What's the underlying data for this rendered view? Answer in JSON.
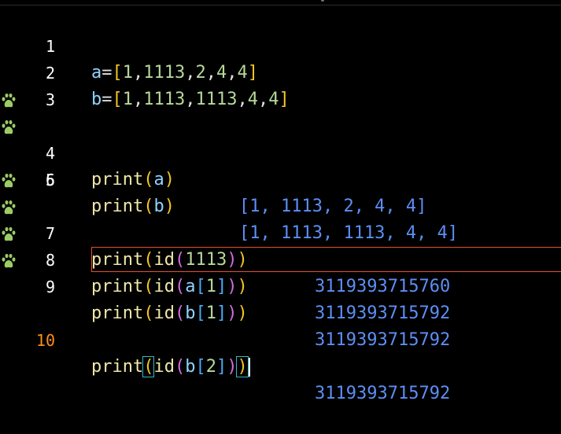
{
  "editor": {
    "active_line": "10",
    "lines": [
      {
        "num": "1",
        "code": [
          "a",
          "=",
          "[",
          "1",
          ",",
          "1113",
          ",",
          "2",
          ",",
          "4",
          ",",
          "4",
          "]"
        ],
        "result": ""
      },
      {
        "num": "2",
        "code": [
          "b",
          "=",
          "[",
          "1",
          ",",
          "1113",
          ",",
          "1113",
          ",",
          "4",
          ",",
          "4",
          "]"
        ],
        "result": ""
      },
      {
        "num": "3",
        "code": [],
        "result": ""
      },
      {
        "num": "4",
        "code": [
          "print",
          "(",
          "a",
          ")"
        ],
        "result": "[1, 1113, 2, 4, 4]"
      },
      {
        "num": "5",
        "code": [
          "print",
          "(",
          "b",
          ")"
        ],
        "result": "[1, 1113, 1113, 4, 4]"
      },
      {
        "num": "6",
        "code": [],
        "result": ""
      },
      {
        "num": "7",
        "code": [
          "print",
          "(",
          "id",
          "(",
          "1113",
          ")",
          ")"
        ],
        "result": "3119393715760"
      },
      {
        "num": "8",
        "code": [
          "print",
          "(",
          "id",
          "(",
          "a",
          "[",
          "1",
          "]",
          ")",
          ")"
        ],
        "result": "3119393715792"
      },
      {
        "num": "9",
        "code": [
          "print",
          "(",
          "id",
          "(",
          "b",
          "[",
          "1",
          "]",
          ")",
          ")"
        ],
        "result": "3119393715792"
      },
      {
        "num": "10",
        "code": [
          "print",
          "(",
          "id",
          "(",
          "b",
          "[",
          "2",
          "]",
          ")",
          ")"
        ],
        "result": "3119393715792"
      }
    ]
  },
  "colors": {
    "background": "#000000",
    "line_number": "#ffffff",
    "active_line_number": "#ff8c1a",
    "result_text": "#5c8ff5",
    "run_icon": "#9ccc65",
    "current_line_border": "#e6502e"
  },
  "icons": {
    "run_marker": "paw-print-icon"
  }
}
